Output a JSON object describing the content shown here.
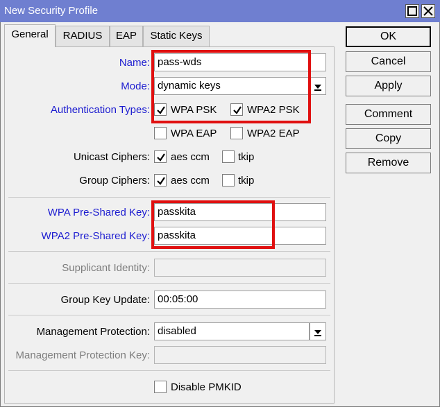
{
  "window": {
    "title": "New Security Profile"
  },
  "tabs": [
    {
      "label": "General",
      "active": true
    },
    {
      "label": "RADIUS",
      "active": false
    },
    {
      "label": "EAP",
      "active": false
    },
    {
      "label": "Static Keys",
      "active": false
    }
  ],
  "form": {
    "name_label": "Name:",
    "name_value": "pass-wds",
    "mode_label": "Mode:",
    "mode_value": "dynamic keys",
    "auth_label": "Authentication Types:",
    "auth_options": [
      {
        "label": "WPA PSK",
        "checked": true
      },
      {
        "label": "WPA2 PSK",
        "checked": true
      },
      {
        "label": "WPA EAP",
        "checked": false
      },
      {
        "label": "WPA2 EAP",
        "checked": false
      }
    ],
    "unicast_label": "Unicast Ciphers:",
    "unicast_options": [
      {
        "label": "aes ccm",
        "checked": true
      },
      {
        "label": "tkip",
        "checked": false
      }
    ],
    "group_label": "Group Ciphers:",
    "group_options": [
      {
        "label": "aes ccm",
        "checked": true
      },
      {
        "label": "tkip",
        "checked": false
      }
    ],
    "wpa_key_label": "WPA Pre-Shared Key:",
    "wpa_key_value": "passkita",
    "wpa2_key_label": "WPA2 Pre-Shared Key:",
    "wpa2_key_value": "passkita",
    "supplicant_label": "Supplicant Identity:",
    "supplicant_value": "",
    "gku_label": "Group Key Update:",
    "gku_value": "00:05:00",
    "mgmt_label": "Management Protection:",
    "mgmt_value": "disabled",
    "mgmt_key_label": "Management Protection Key:",
    "mgmt_key_value": "",
    "pmkid_label": "Disable PMKID",
    "pmkid_checked": false
  },
  "buttons": {
    "ok": "OK",
    "cancel": "Cancel",
    "apply": "Apply",
    "comment": "Comment",
    "copy": "Copy",
    "remove": "Remove"
  },
  "colors": {
    "titlebar": "#6f7fd0",
    "label_blue": "#1c1cd0",
    "label_gray": "#7d7d7d",
    "highlight_red": "#e01010"
  }
}
